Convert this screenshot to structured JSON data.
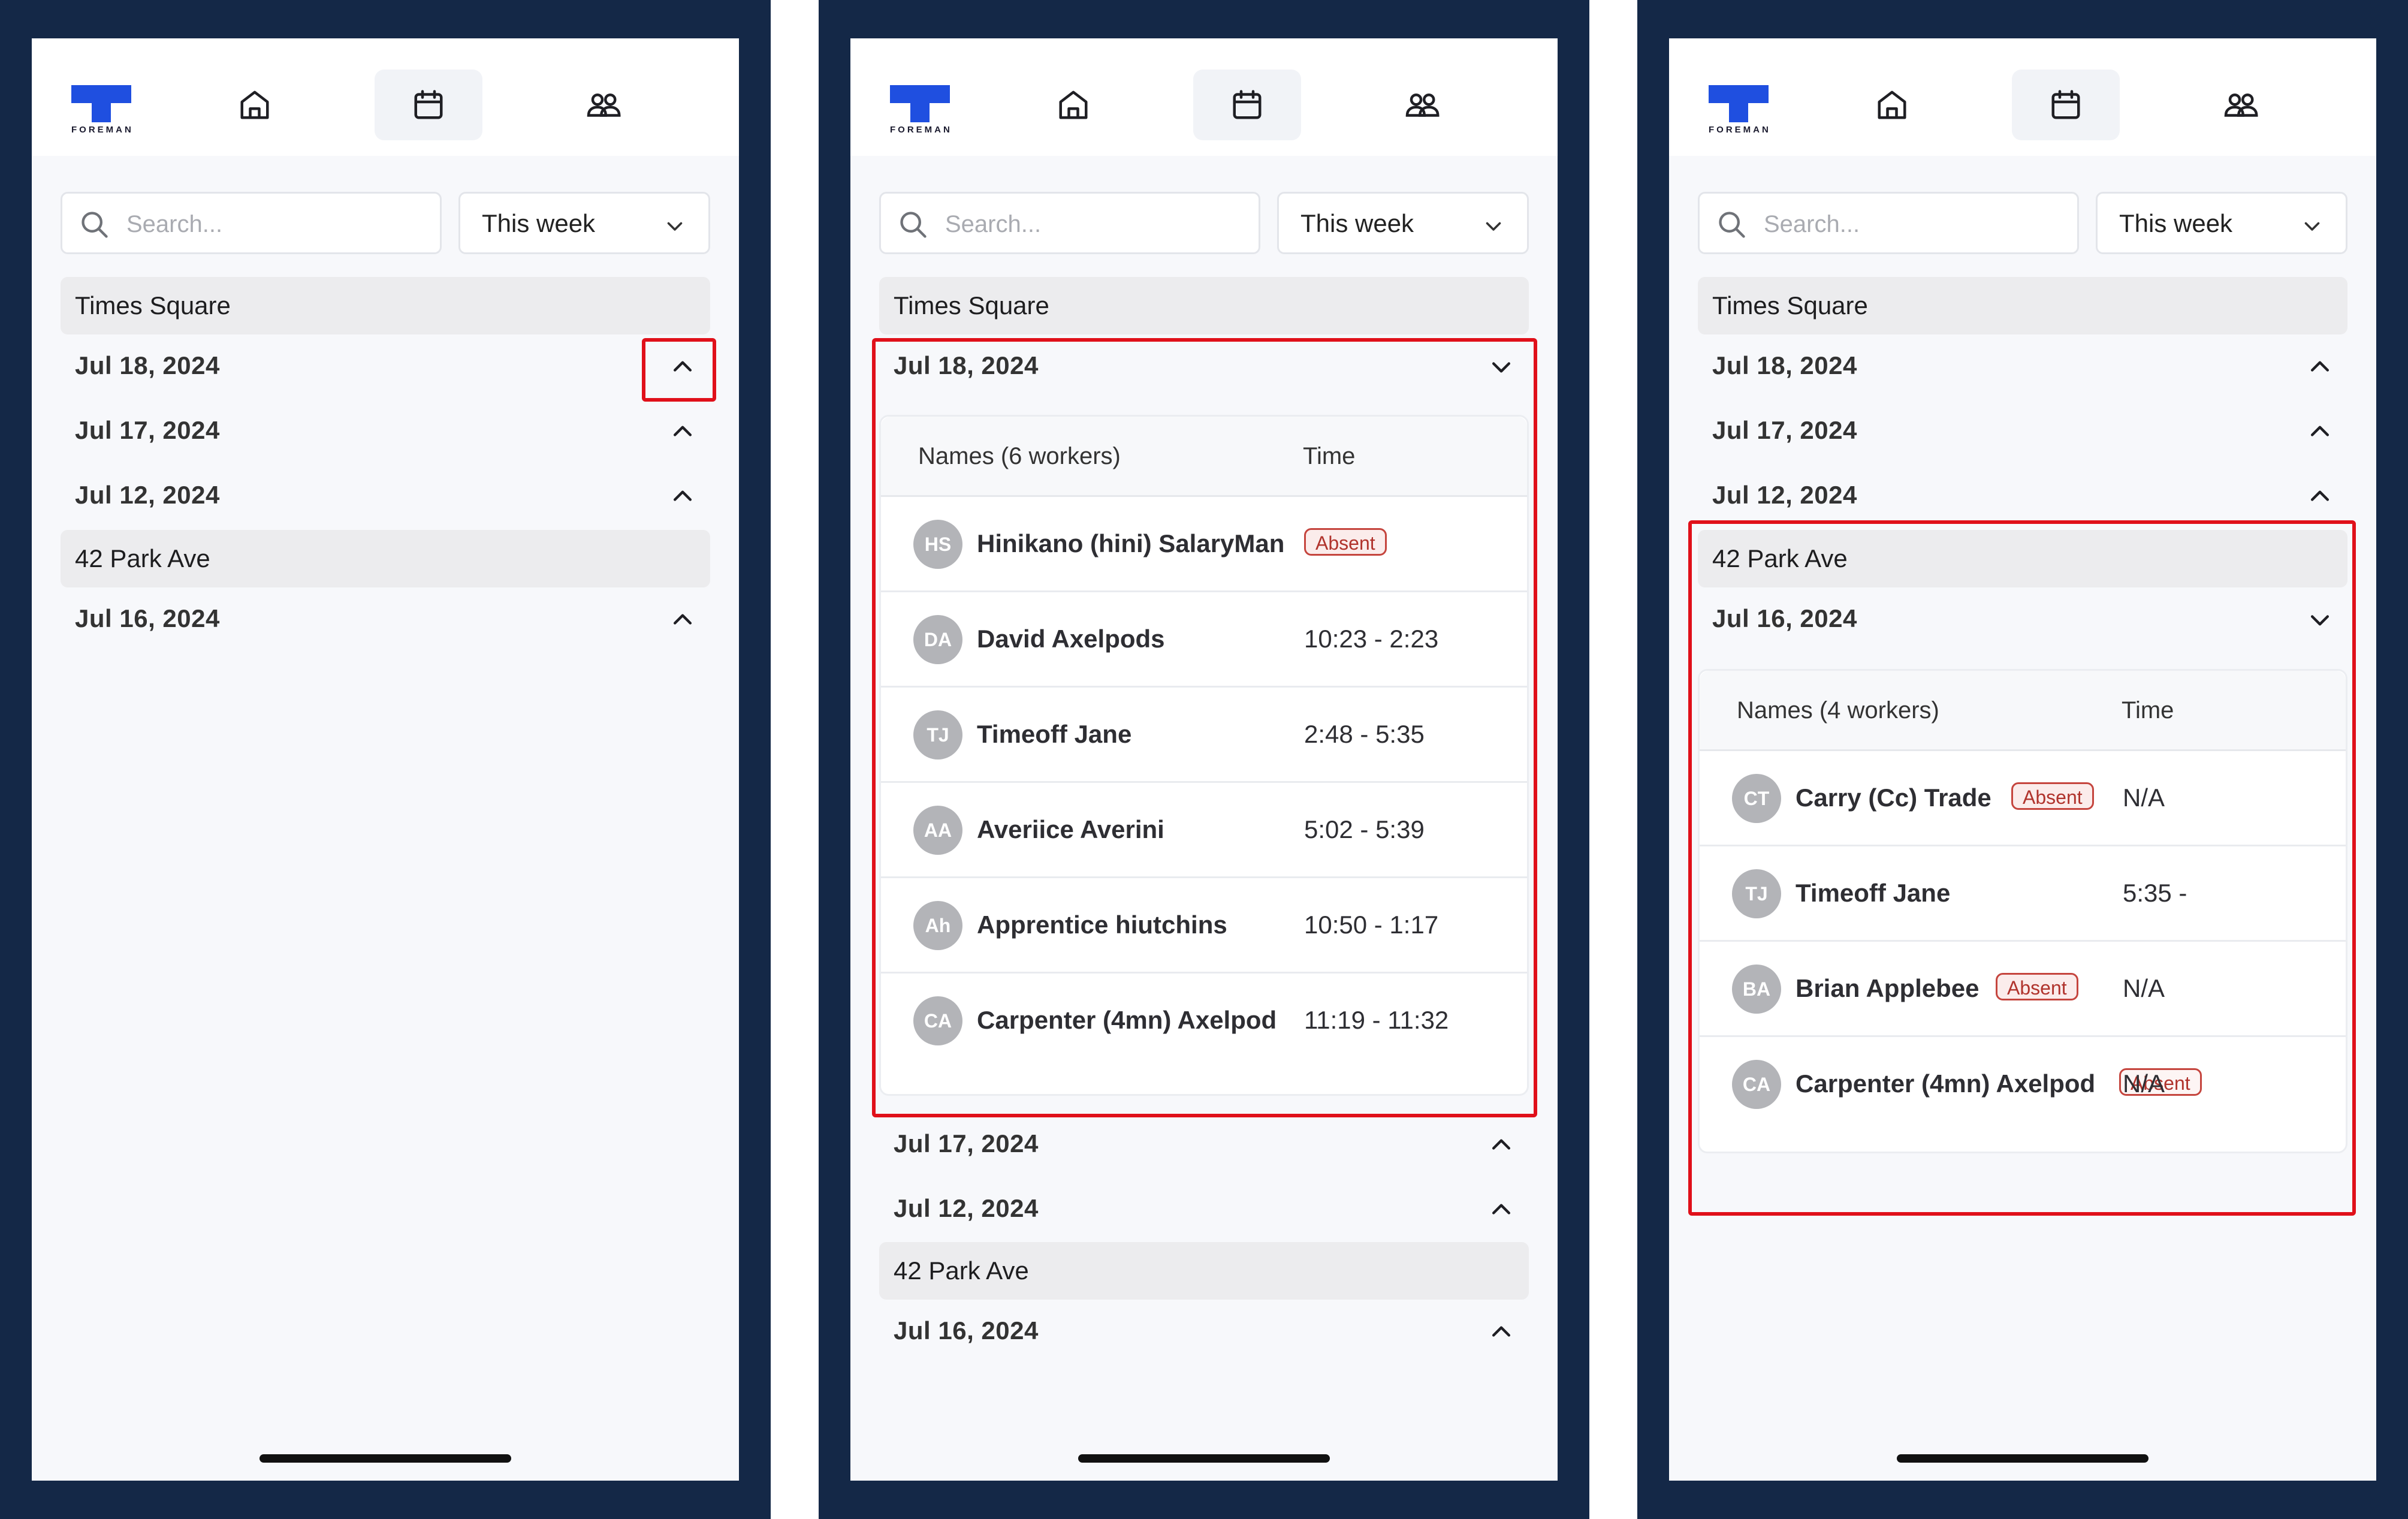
{
  "app": {
    "logo_text": "FOREMAN",
    "brand_color": "#1f4fe0",
    "nav": [
      {
        "icon": "home-icon"
      },
      {
        "icon": "calendar-icon",
        "active": true
      },
      {
        "icon": "people-icon"
      }
    ],
    "search_placeholder": "Search...",
    "week_filter": "This week"
  },
  "panels": [
    {
      "locations": [
        {
          "name": "Times Square",
          "dates": [
            "Jul 18, 2024",
            "Jul 17, 2024",
            "Jul 12, 2024"
          ]
        },
        {
          "name": "42 Park Ave",
          "dates": [
            "Jul 16, 2024"
          ]
        }
      ]
    },
    {
      "locations": [
        {
          "name": "Times Square",
          "dates": [
            "Jul 18, 2024",
            "Jul 17, 2024",
            "Jul 12, 2024"
          ]
        },
        {
          "name": "42 Park Ave",
          "dates": [
            "Jul 16, 2024"
          ]
        }
      ],
      "expanded": {
        "header_names": "Names (6 workers)",
        "header_time": "Time",
        "workers": [
          {
            "initials": "HS",
            "name": "Hinikano (hini) SalaryMan",
            "badge": "Absent",
            "time": ""
          },
          {
            "initials": "DA",
            "name": "David Axelpods",
            "badge": "",
            "time": "10:23 - 2:23"
          },
          {
            "initials": "TJ",
            "name": "Timeoff Jane",
            "badge": "",
            "time": "2:48 - 5:35"
          },
          {
            "initials": "AA",
            "name": "Averiice Averini",
            "badge": "",
            "time": "5:02 - 5:39"
          },
          {
            "initials": "Ah",
            "name": "Apprentice hiutchins",
            "badge": "",
            "time": "10:50 - 1:17"
          },
          {
            "initials": "CA",
            "name": "Carpenter (4mn) Axelpod",
            "badge": "",
            "time": "11:19 - 11:32"
          }
        ]
      }
    },
    {
      "locations": [
        {
          "name": "Times Square",
          "dates": [
            "Jul 18, 2024",
            "Jul 17, 2024",
            "Jul 12, 2024"
          ]
        },
        {
          "name": "42 Park Ave",
          "dates": [
            "Jul 16, 2024"
          ]
        }
      ],
      "expanded": {
        "header_names": "Names (4 workers)",
        "header_time": "Time",
        "workers": [
          {
            "initials": "CT",
            "name": "Carry (Cc) Trade",
            "badge": "Absent",
            "time": "N/A"
          },
          {
            "initials": "TJ",
            "name": "Timeoff Jane",
            "badge": "",
            "time": "5:35 -"
          },
          {
            "initials": "BA",
            "name": "Brian Applebee",
            "badge": "Absent",
            "time": "N/A"
          },
          {
            "initials": "CA",
            "name": "Carpenter (4mn) Axelpod",
            "badge": "Absent",
            "time": "N/A"
          }
        ]
      }
    }
  ]
}
